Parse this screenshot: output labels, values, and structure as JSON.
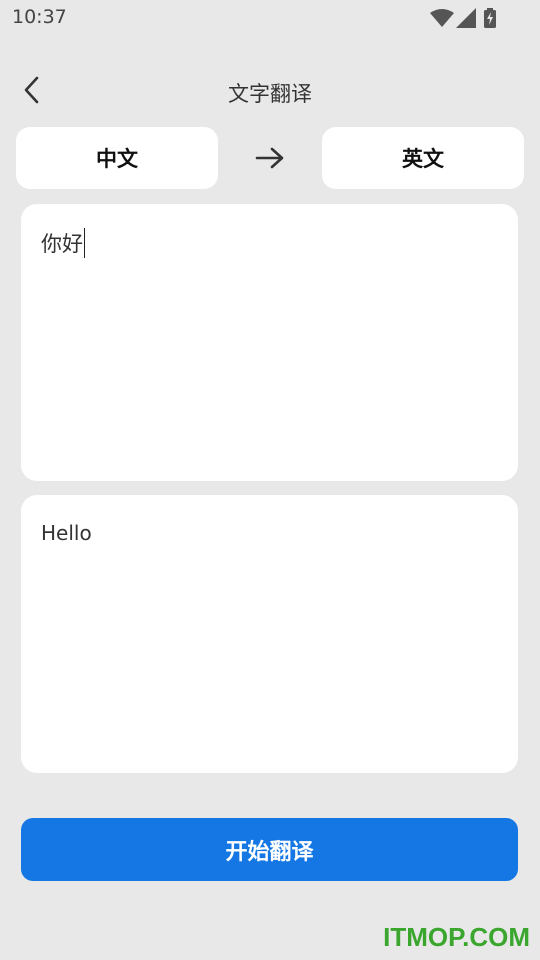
{
  "status_bar": {
    "time": "10:37",
    "icons": [
      "wifi-icon",
      "cell-signal-icon",
      "battery-charging-icon"
    ]
  },
  "app_bar": {
    "back_icon": "chevron-left-icon",
    "title": "文字翻译"
  },
  "languages": {
    "source": "中文",
    "target": "英文",
    "arrow_icon": "arrow-right-icon"
  },
  "input": {
    "value": "你好"
  },
  "output": {
    "value": "Hello"
  },
  "actions": {
    "translate_label": "开始翻译"
  },
  "watermark": {
    "text": "ITMOP.COM"
  },
  "colors": {
    "background": "#e8e8e8",
    "card": "#ffffff",
    "primary": "#1577e3",
    "watermark": "#3aa62e"
  }
}
